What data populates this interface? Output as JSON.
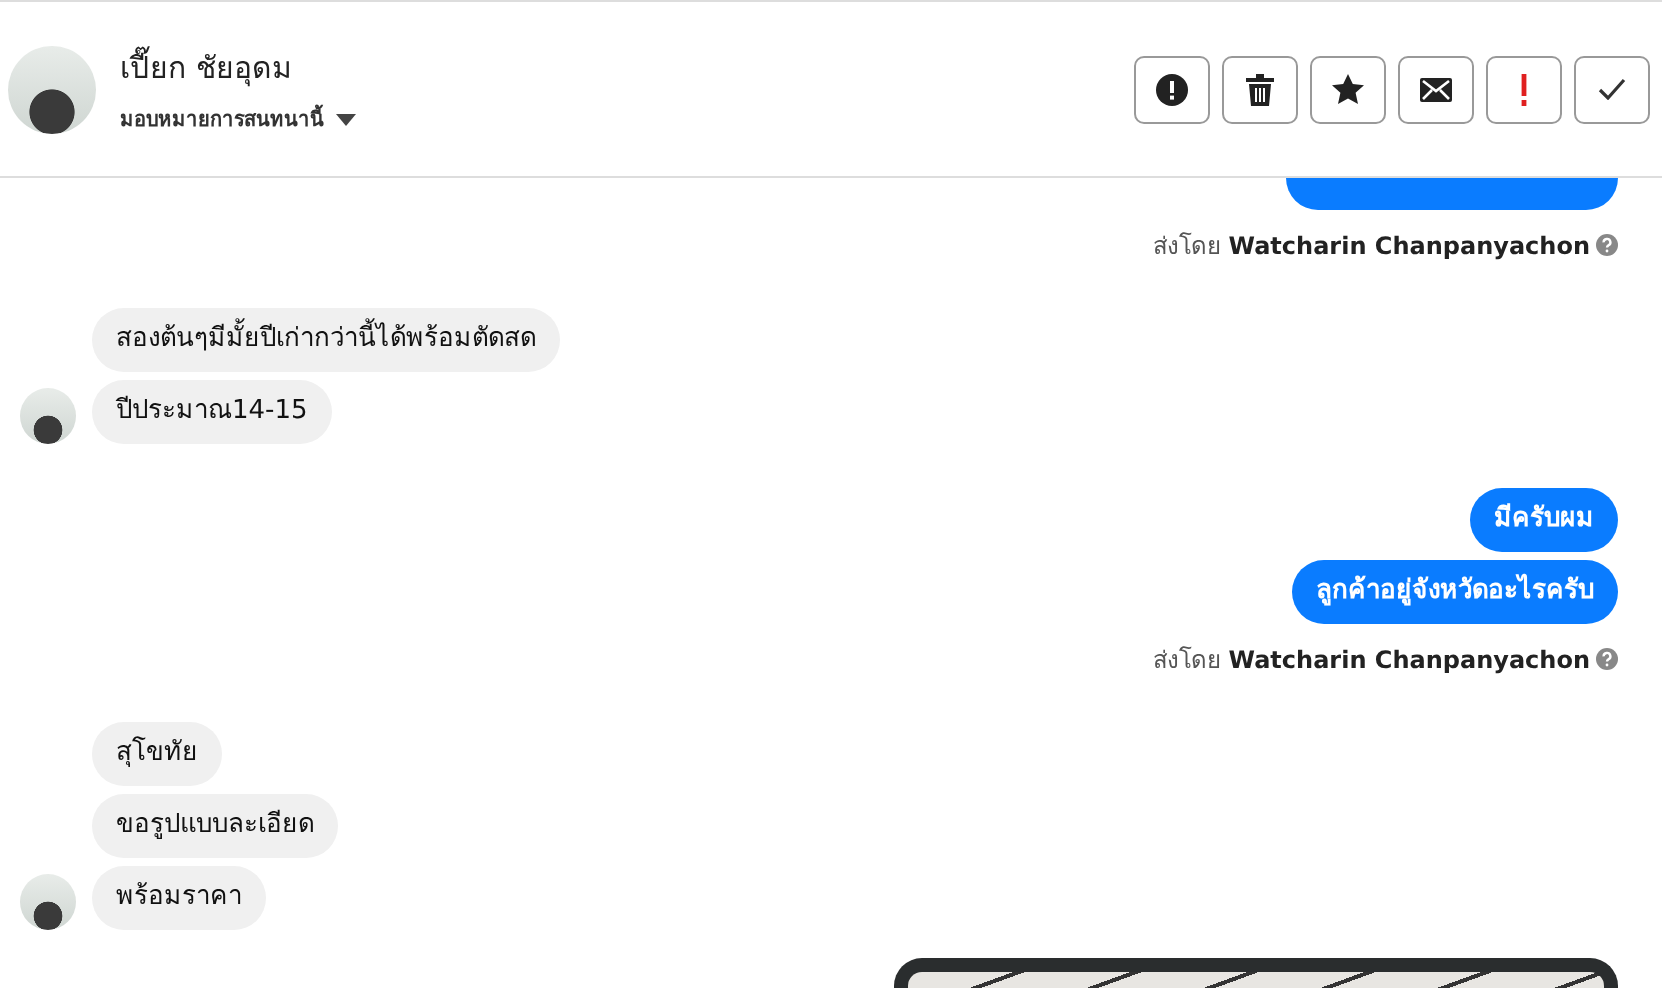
{
  "header": {
    "name": "เปี๊ยก ชัยอุดม",
    "assign_label": "มอบหมายการสนทนานี้",
    "actions": [
      {
        "kind": "alert"
      },
      {
        "kind": "trash"
      },
      {
        "kind": "star"
      },
      {
        "kind": "envelope"
      },
      {
        "kind": "important"
      },
      {
        "kind": "check"
      }
    ]
  },
  "messages": [
    {
      "kind": "outgoing_cut",
      "sent_by_prefix": "ส่งโดย",
      "sent_by": "Watcharin Chanpanyachon"
    },
    {
      "kind": "incoming",
      "bubbles": [
        "สองต้นๆมีมั้ยปีเก่ากว่านี้ได้พร้อมตัดสด",
        "ปีประมาณ14-15"
      ]
    },
    {
      "kind": "outgoing",
      "bubbles": [
        "มีครับผม",
        "ลูกค้าอยู่จังหวัดอะไรครับ"
      ],
      "sent_by_prefix": "ส่งโดย",
      "sent_by": "Watcharin Chanpanyachon"
    },
    {
      "kind": "incoming",
      "bubbles": [
        "สุโขทัย",
        "ขอรูปแบบละเอียด",
        "พร้อมราคา"
      ]
    },
    {
      "kind": "image"
    }
  ]
}
